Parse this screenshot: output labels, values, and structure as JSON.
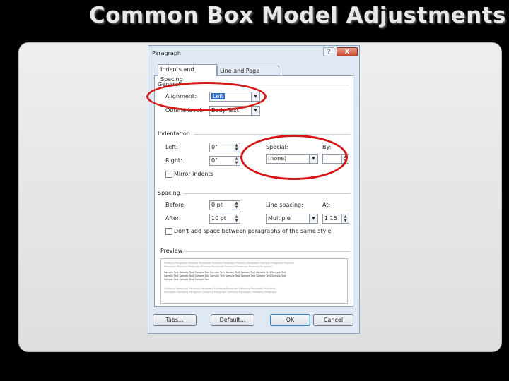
{
  "slide": {
    "title": "Common Box Model Adjustments"
  },
  "dialog": {
    "title": "Paragraph",
    "help_glyph": "?",
    "close_glyph": "X",
    "tabs": [
      "Indents and Spacing",
      "Line and Page Breaks"
    ],
    "general": {
      "heading": "General",
      "alignment_label": "Alignment:",
      "alignment_value": "Left",
      "outline_label": "Outline level:",
      "outline_value": "Body Text"
    },
    "indentation": {
      "heading": "Indentation",
      "left_label": "Left:",
      "left_value": "0\"",
      "right_label": "Right:",
      "right_value": "0\"",
      "special_label": "Special:",
      "special_value": "(none)",
      "by_label": "By:",
      "by_value": "",
      "mirror_label": "Mirror indents",
      "mirror_checked": false
    },
    "spacing": {
      "heading": "Spacing",
      "before_label": "Before:",
      "before_value": "0 pt",
      "after_label": "After:",
      "after_value": "10 pt",
      "line_spacing_label": "Line spacing:",
      "line_spacing_value": "Multiple",
      "at_label": "At:",
      "at_value": "1.15",
      "dont_add_label": "Don't add space between paragraphs of the same style",
      "dont_add_checked": false
    },
    "preview": {
      "heading": "Preview",
      "previous_lines": [
        "Previous Paragraph Previous Paragraph Previous Paragraph Previous Paragraph Previous Paragraph Previous",
        "Paragraph Previous Paragraph Previous Paragraph Previous Paragraph Previous Paragraph"
      ],
      "sample_lines": [
        "Sample Text Sample Text Sample Text Sample Text Sample Text Sample Text Sample Text Sample Text",
        "Sample Text Sample Text Sample Text Sample Text Sample Text Sample Text Sample Text Sample Text",
        "Sample Text Sample Text Sample Text"
      ],
      "following_lines": [
        "Following Paragraph Following Paragraph Following Paragraph Following Paragraph Following",
        "Paragraph Following Paragraph Following Paragraph Following Paragraph Following Paragraph"
      ]
    },
    "buttons": {
      "tabs": "Tabs...",
      "default": "Default...",
      "ok": "OK",
      "cancel": "Cancel"
    }
  },
  "annotation_color": "#d31818"
}
